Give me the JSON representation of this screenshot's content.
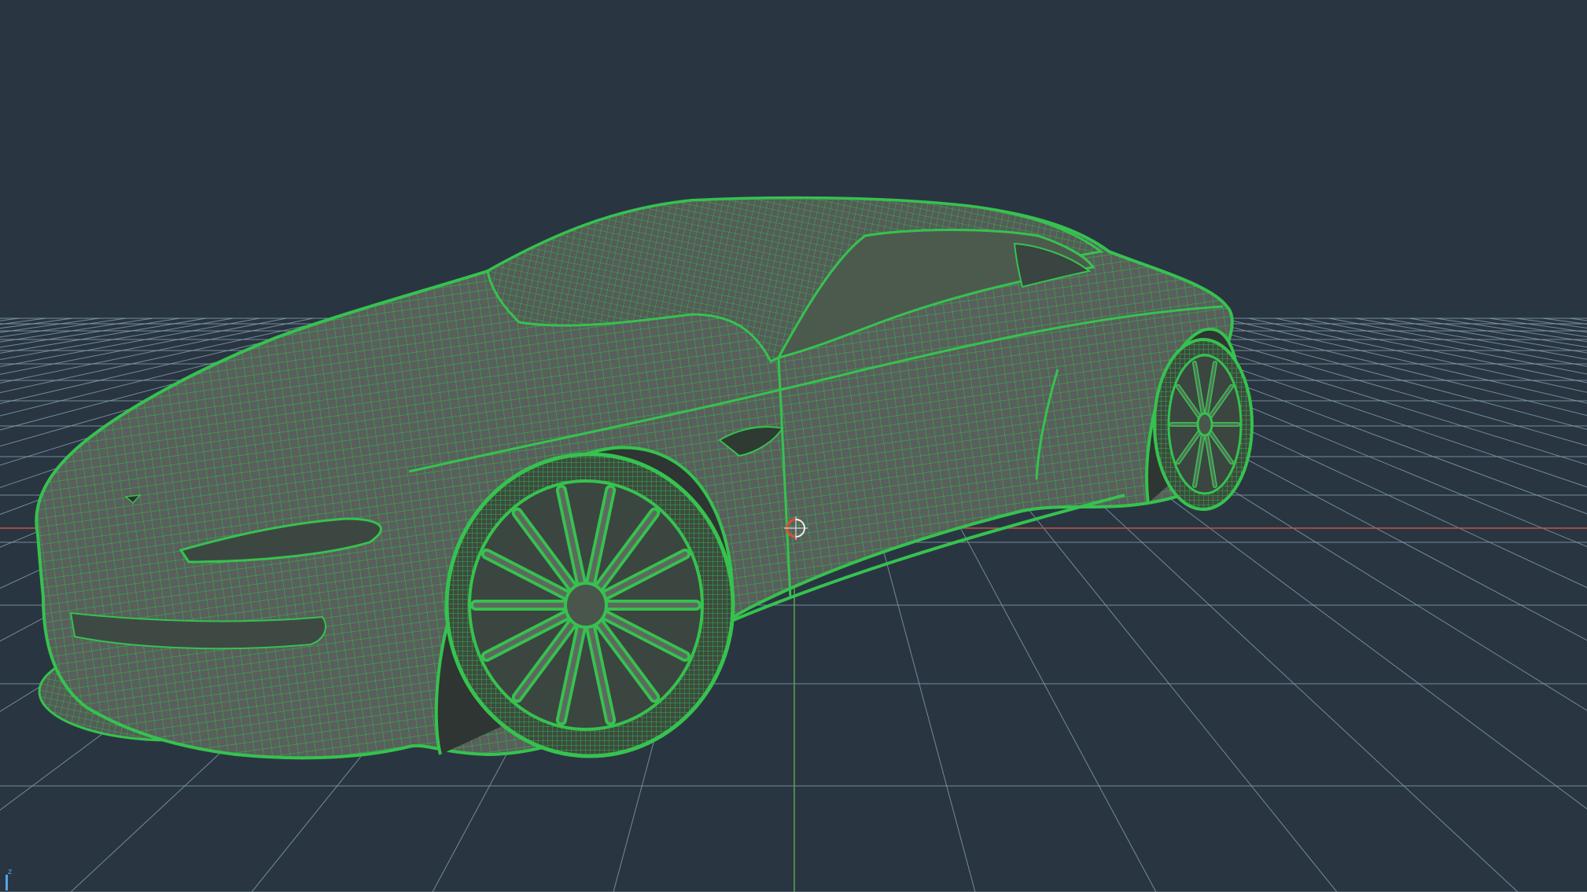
{
  "viewport": {
    "background_color": "#2a3542",
    "grid_color": "#8aa7b5",
    "x_axis_color": "#c4553d",
    "y_axis_color": "#5fa24a",
    "wireframe_fill": "#5a5f5a",
    "wireframe_color": "#2fb04a",
    "wireframe_edge_color": "#36c24f",
    "object_name": "car-wireframe-model",
    "display_mode": "wireframe-on-shaded"
  },
  "pivot": {
    "icon": "transform-pivot-icon",
    "color_primary": "#e04a3a",
    "color_secondary": "#f0f0f0"
  },
  "axis_indicator": {
    "label": "z",
    "color": "#4fa8e8"
  }
}
